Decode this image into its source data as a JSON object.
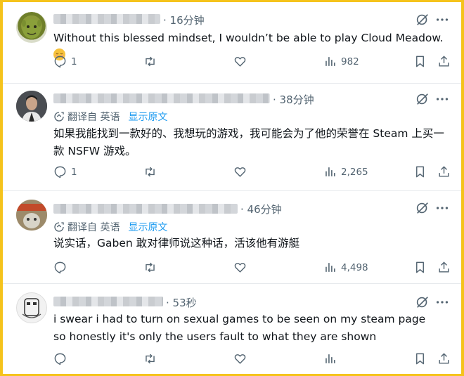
{
  "colors": {
    "frame_border": "#f5c31c",
    "link": "#1d9bf0",
    "muted": "#536471",
    "text": "#0f1419"
  },
  "tweets": [
    {
      "time": "· 16分钟",
      "text": "Without this blessed mindset, I wouldn’t be able to play Cloud Meadow.",
      "emoji": "relieved-face",
      "avatar": "shrek-avatar",
      "reply_count": "1",
      "view_count": "982"
    },
    {
      "time": "· 38分钟",
      "translation": {
        "label": "翻译自 英语",
        "show_original": "显示原文"
      },
      "text": "如果我能找到一款好的、我想玩的游戏，我可能会为了他的荣誉在 Steam 上买一款 NSFW 游戏。",
      "avatar": "man-portrait-avatar",
      "reply_count": "1",
      "view_count": "2,265"
    },
    {
      "time": "· 46分钟",
      "translation": {
        "label": "翻译自 英语",
        "show_original": "显示原文"
      },
      "text": "说实话，Gaben 敢对律师说这种话，活该他有游艇",
      "avatar": "cartoon-avatar",
      "reply_count": "",
      "view_count": "4,498"
    },
    {
      "time": "· 53秒",
      "text": "i swear i had to turn on sexual games to be seen on my steam page so honestly it's only the users fault to what they are shown",
      "avatar": "sketch-avatar",
      "reply_count": "",
      "view_count": ""
    }
  ],
  "icons": [
    "grok-icon",
    "more-icon",
    "reply-icon",
    "retweet-icon",
    "like-icon",
    "views-icon",
    "bookmark-icon",
    "share-icon",
    "translate-icon"
  ]
}
